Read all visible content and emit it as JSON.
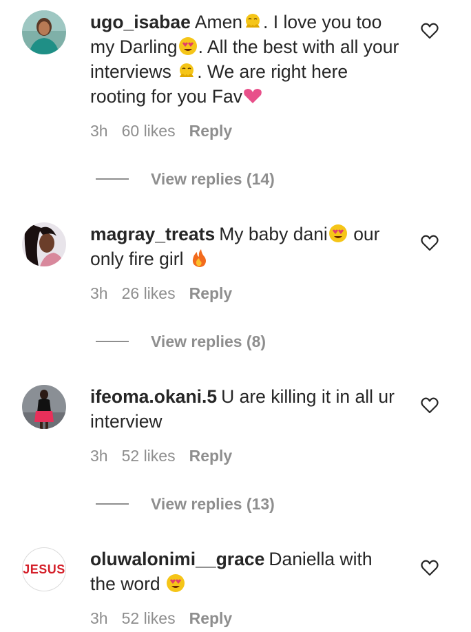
{
  "comments": [
    {
      "username": "ugo_isabae",
      "segments": [
        "Amen",
        ". I love you too my Darling",
        ". All the best with all your interviews ",
        ". We are right here rooting for you Fav"
      ],
      "time": "3h",
      "likes": "60 likes",
      "reply": "Reply",
      "view_replies": "View replies (14)",
      "avatar_icon": "profile-photo-icon"
    },
    {
      "username": "magray_treats",
      "segments": [
        "My baby dani",
        " our only fire girl "
      ],
      "time": "3h",
      "likes": "26 likes",
      "reply": "Reply",
      "view_replies": "View replies (8)",
      "avatar_icon": "profile-photo-icon"
    },
    {
      "username": "ifeoma.okani.5",
      "segments": [
        "U are killing it in all ur interview"
      ],
      "time": "3h",
      "likes": "52 likes",
      "reply": "Reply",
      "view_replies": "View replies (13)",
      "avatar_icon": "profile-photo-icon"
    },
    {
      "username": "oluwalonimi__grace",
      "segments": [
        "Daniella with the word "
      ],
      "time": "3h",
      "likes": "52 likes",
      "reply": "Reply",
      "avatar_text": "JESUS",
      "avatar_icon": "jesus-logo-icon"
    }
  ],
  "colors": {
    "text": "#262626",
    "muted": "#8e8e8e",
    "avatar_red": "#d4202a"
  },
  "icons": [
    "heart-outline-icon",
    "hands-emoji-icon",
    "heart-eyes-emoji-icon",
    "pink-heart-emoji-icon",
    "fire-emoji-icon"
  ]
}
